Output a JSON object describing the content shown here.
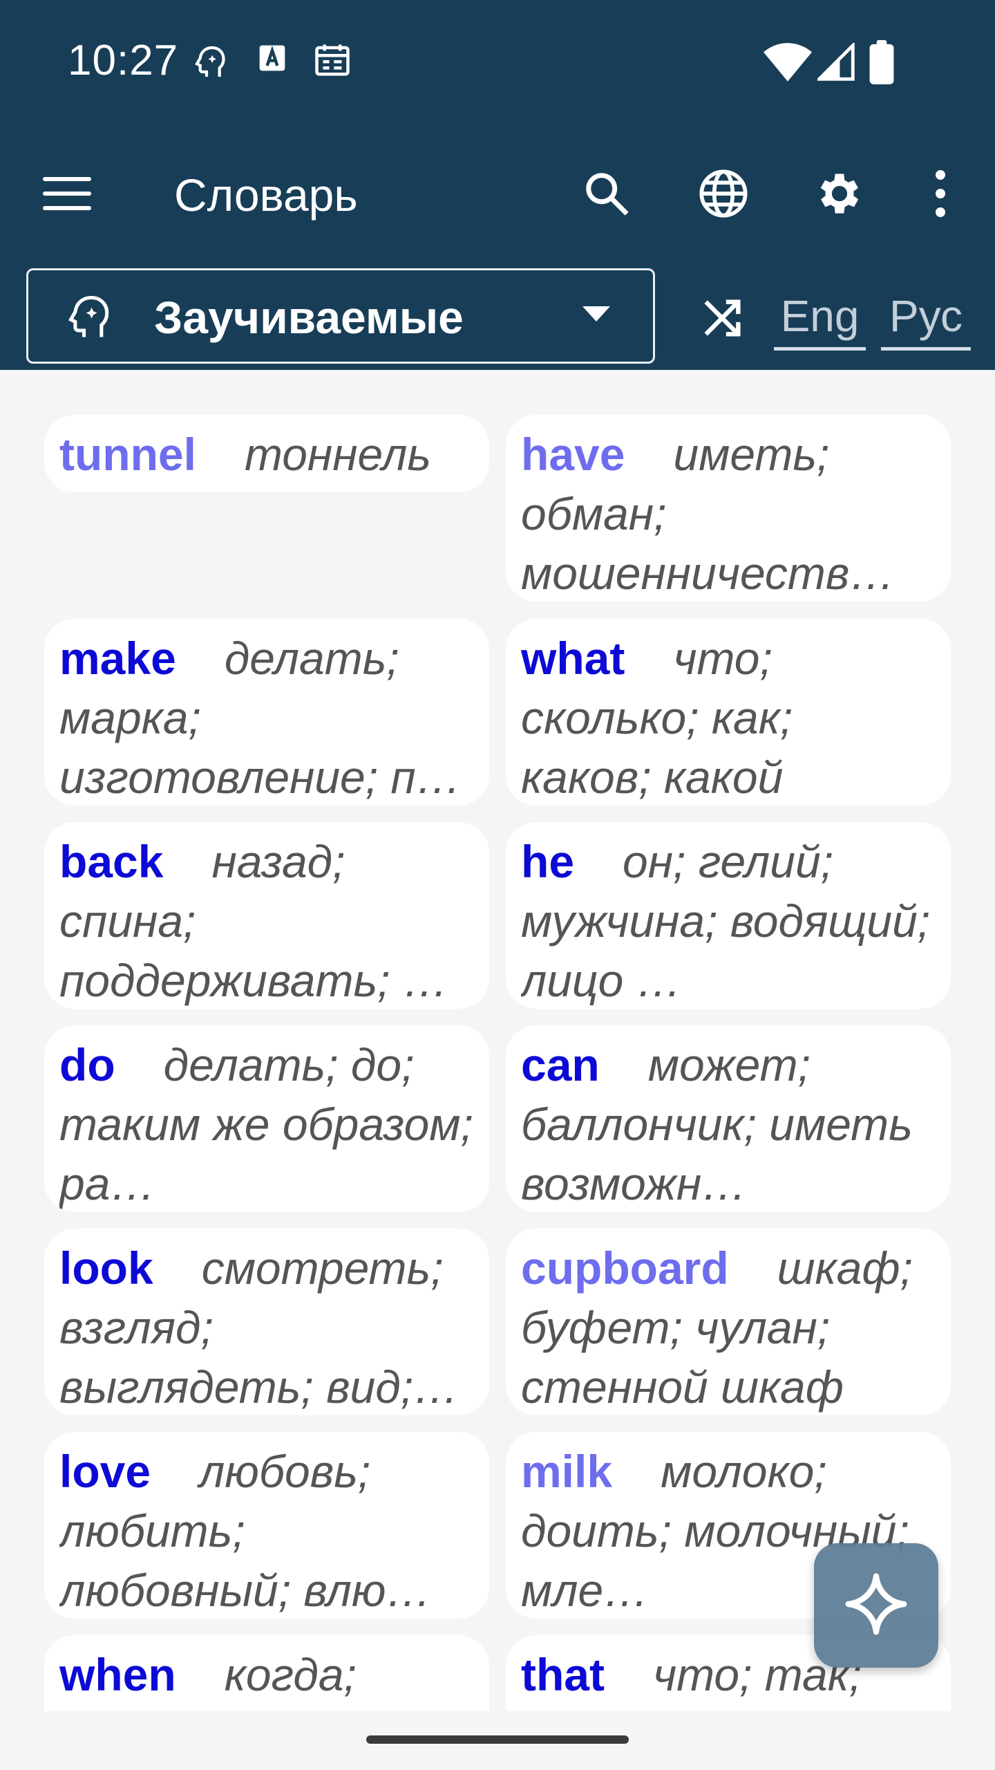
{
  "status_bar": {
    "time": "10:27"
  },
  "app_bar": {
    "title": "Словарь"
  },
  "filter": {
    "label": "Заучиваемые"
  },
  "languages": {
    "english": "Eng",
    "russian": "Рус"
  },
  "colors": {
    "header": "#183d57",
    "known_word": "#0d0ad6",
    "learning_word": "#6e6ded",
    "fab": "#5f7f97"
  },
  "words": [
    {
      "word": "tunnel",
      "translation": "тоннель",
      "state": "learning"
    },
    {
      "word": "have",
      "translation": "иметь; обман; мошенничеств…",
      "state": "learning"
    },
    {
      "word": "make",
      "translation": "делать; марка; изготовление; п…",
      "state": "known"
    },
    {
      "word": "what",
      "translation": "что; сколько; как; каков; какой",
      "state": "known"
    },
    {
      "word": "back",
      "translation": "назад; спина; поддерживать; …",
      "state": "known"
    },
    {
      "word": "he",
      "translation": "он; гелий; мужчина; водящий; лицо …",
      "state": "known"
    },
    {
      "word": "do",
      "translation": "делать; до; таким же образом; ра…",
      "state": "known"
    },
    {
      "word": "can",
      "translation": "может; баллончик; иметь возможн…",
      "state": "known"
    },
    {
      "word": "look",
      "translation": "смотреть; взгляд; выглядеть; вид;…",
      "state": "known"
    },
    {
      "word": "cupboard",
      "translation": "шкаф; буфет; чулан; стенной шкаф",
      "state": "learning"
    },
    {
      "word": "love",
      "translation": "любовь; любить; любовный; влю…",
      "state": "known"
    },
    {
      "word": "milk",
      "translation": "молоко; доить; молочный; мле…",
      "state": "learning"
    },
    {
      "word": "when",
      "translation": "когда;",
      "state": "known"
    },
    {
      "word": "that",
      "translation": "что; так;",
      "state": "known"
    }
  ]
}
